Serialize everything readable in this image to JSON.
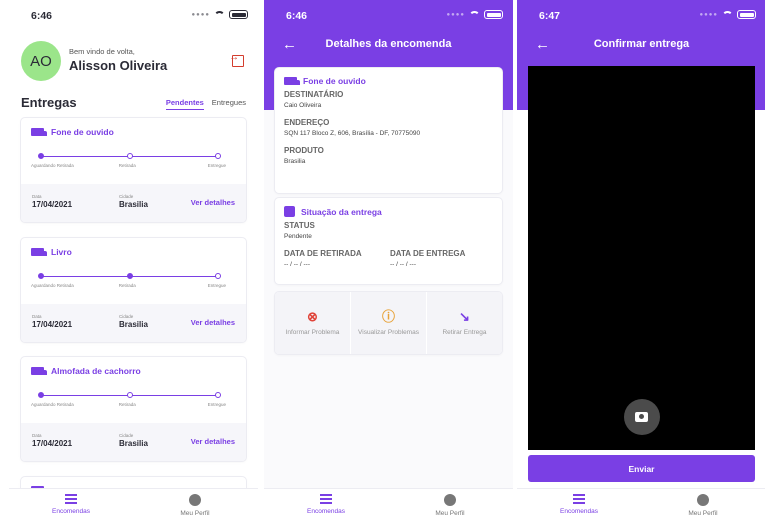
{
  "colors": {
    "accent": "#7a3fe4",
    "avatar": "#9be58a",
    "logout": "#d43d2e"
  },
  "status_time_1": "6:46",
  "status_time_2": "6:46",
  "status_time_3": "6:47",
  "home": {
    "avatar_initials": "AO",
    "welcome": "Bem vindo de volta,",
    "user_name": "Alisson Oliveira",
    "section_title": "Entregas",
    "tabs": [
      {
        "label": "Pendentes",
        "active": true
      },
      {
        "label": "Entregues",
        "active": false
      }
    ],
    "step_labels": [
      "Aguardando Retirada",
      "Retirada",
      "Entregue"
    ],
    "date_label": "Data",
    "city_label": "Cidade",
    "details_label": "Ver detalhes",
    "deliveries": [
      {
        "name": "Fone de ouvido",
        "progress_step": 1,
        "date": "17/04/2021",
        "city": "Brasilia"
      },
      {
        "name": "Livro",
        "progress_step": 2,
        "date": "17/04/2021",
        "city": "Brasilia"
      },
      {
        "name": "Almofada de cachorro",
        "progress_step": 1,
        "date": "17/04/2021",
        "city": "Brasilia"
      }
    ]
  },
  "details": {
    "title": "Detalhes da encomenda",
    "product_name": "Fone de ouvido",
    "recipient_label": "DESTINATÁRIO",
    "recipient": "Caio Oliveira",
    "address_label": "ENDEREÇO",
    "address": "SQN 117 Bloco Z, 606, Brasília - DF, 70775090",
    "product_label": "PRODUTO",
    "product_city": "Brasilia",
    "status_section": "Situação da entrega",
    "status_label": "STATUS",
    "status": "Pendente",
    "pickup_label": "DATA DE RETIRADA",
    "pickup_value": "-- / -- / ---",
    "delivery_label": "DATA DE ENTREGA",
    "delivery_value": "-- / -- / ---",
    "actions": [
      "Informar Problema",
      "Visualizar Problemas",
      "Retirar Entrega"
    ]
  },
  "confirm": {
    "title": "Confirmar entrega",
    "send_label": "Enviar"
  },
  "tabbar": {
    "orders": "Encomendas",
    "profile": "Meu Perfil"
  }
}
